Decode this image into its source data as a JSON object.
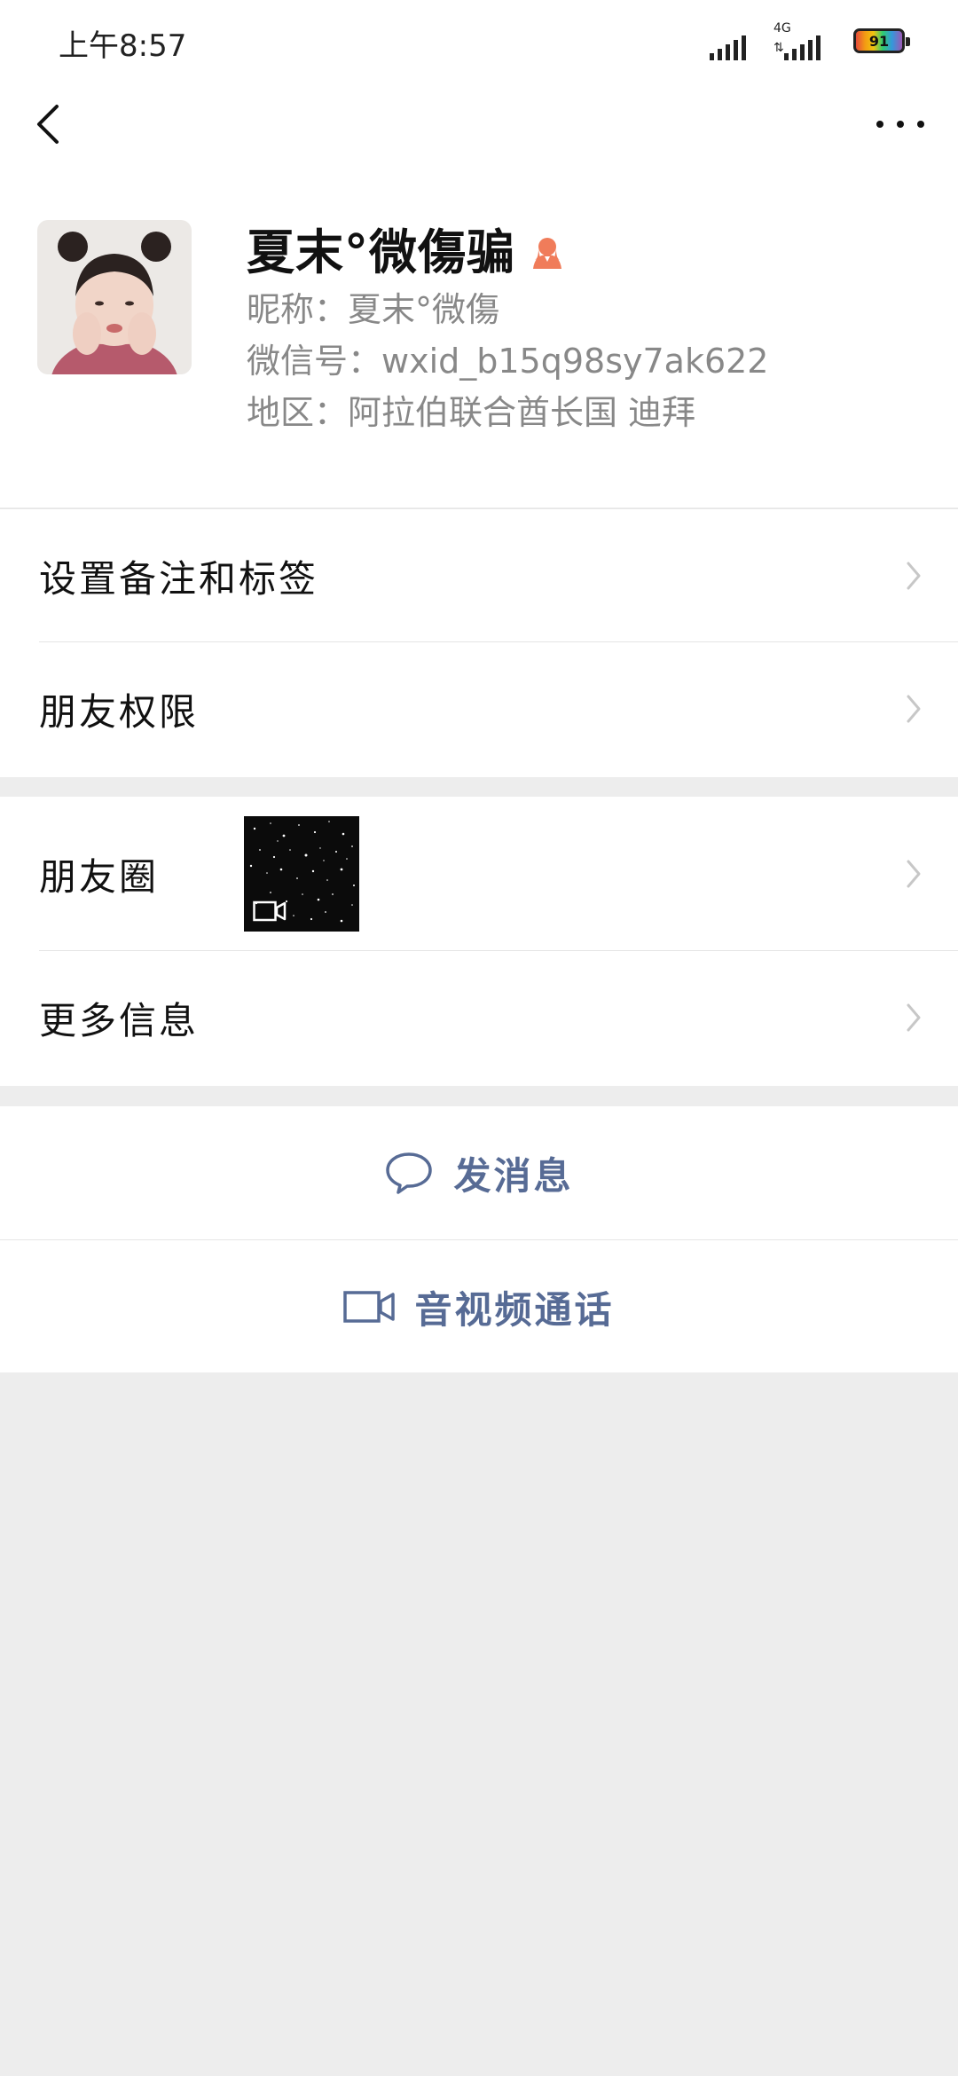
{
  "status_bar": {
    "time": "上午8:57",
    "network": "4G",
    "network_arrows": "⇅",
    "battery": "91"
  },
  "nav": {
    "back_icon": "chevron-left-icon",
    "more_icon": "more-dots-icon"
  },
  "profile": {
    "display_name": "夏末°微傷骗",
    "gender_icon": "female-icon",
    "nickname": "昵称：夏末°微傷",
    "wechat_id": "微信号：wxid_b15q98sy7ak622",
    "region": "地区：阿拉伯联合酋长国 迪拜"
  },
  "menu": {
    "remark_tags": "设置备注和标签",
    "friend_permissions": "朋友权限",
    "moments": "朋友圈",
    "more_info": "更多信息"
  },
  "actions": {
    "send_message": "发消息",
    "av_call": "音视频通话"
  },
  "colors": {
    "link_blue": "#576b95",
    "female_icon": "#f07c5a",
    "background": "#ededed"
  }
}
